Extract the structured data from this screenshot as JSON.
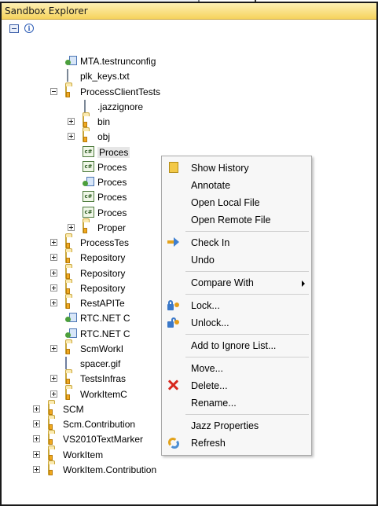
{
  "window": {
    "title": "Sandbox Explorer"
  },
  "toolbar": {
    "collapse_icon": "collapse-all-icon",
    "info_icon": "info-icon",
    "info_glyph": "i"
  },
  "tree": [
    {
      "label": "MTA.testrunconfig",
      "icon": "config-file-icon",
      "toggle": "",
      "indent": 2
    },
    {
      "label": "plk_keys.txt",
      "icon": "text-file-icon",
      "toggle": "",
      "indent": 2
    },
    {
      "label": "ProcessClientTests",
      "icon": "folder-icon",
      "toggle": "minus",
      "indent": 2
    },
    {
      "label": ".jazzignore",
      "icon": "file-icon",
      "toggle": "",
      "indent": 3
    },
    {
      "label": "bin",
      "icon": "folder-icon",
      "toggle": "plus",
      "indent": 3
    },
    {
      "label": "obj",
      "icon": "folder-icon",
      "toggle": "plus",
      "indent": 3
    },
    {
      "label": "Proces",
      "icon": "csharp-file-icon",
      "toggle": "",
      "indent": 3,
      "selected": true
    },
    {
      "label": "Proces",
      "icon": "csharp-file-icon",
      "toggle": "",
      "indent": 3
    },
    {
      "label": "Proces",
      "icon": "config-file-icon",
      "toggle": "",
      "indent": 3
    },
    {
      "label": "Proces",
      "icon": "csharp-file-icon",
      "toggle": "",
      "indent": 3
    },
    {
      "label": "Proces",
      "icon": "csharp-file-icon",
      "toggle": "",
      "indent": 3
    },
    {
      "label": "Proper",
      "icon": "folder-icon",
      "toggle": "plus",
      "indent": 3
    },
    {
      "label": "ProcessTes",
      "icon": "folder-icon",
      "toggle": "plus",
      "indent": 2
    },
    {
      "label": "Repository",
      "icon": "folder-icon",
      "toggle": "plus",
      "indent": 2
    },
    {
      "label": "Repository",
      "icon": "folder-icon",
      "toggle": "plus",
      "indent": 2
    },
    {
      "label": "Repository",
      "icon": "folder-icon",
      "toggle": "plus",
      "indent": 2
    },
    {
      "label": "RestAPITe",
      "icon": "folder-icon",
      "toggle": "plus",
      "indent": 2
    },
    {
      "label": "RTC.NET C",
      "icon": "config-file-icon",
      "toggle": "",
      "indent": 2
    },
    {
      "label": "RTC.NET C",
      "icon": "config-file-icon",
      "toggle": "",
      "indent": 2
    },
    {
      "label": "ScmWorkI",
      "icon": "folder-icon",
      "toggle": "plus",
      "indent": 2
    },
    {
      "label": "spacer.gif",
      "icon": "image-file-icon",
      "toggle": "",
      "indent": 2
    },
    {
      "label": "TestsInfras",
      "icon": "folder-icon",
      "toggle": "plus",
      "indent": 2
    },
    {
      "label": "WorkItemC",
      "icon": "folder-icon",
      "toggle": "plus",
      "indent": 2
    },
    {
      "label": "SCM",
      "icon": "folder-icon",
      "toggle": "plus",
      "indent": 1
    },
    {
      "label": "Scm.Contribution",
      "icon": "folder-icon",
      "toggle": "plus",
      "indent": 1
    },
    {
      "label": "VS2010TextMarker",
      "icon": "folder-icon",
      "toggle": "plus",
      "indent": 1
    },
    {
      "label": "WorkItem",
      "icon": "folder-icon",
      "toggle": "plus",
      "indent": 1
    },
    {
      "label": "WorkItem.Contribution",
      "icon": "folder-icon",
      "toggle": "plus",
      "indent": 1
    }
  ],
  "context_menu": {
    "items": [
      {
        "label": "Show History",
        "icon": "history-icon"
      },
      {
        "label": "Annotate",
        "icon": ""
      },
      {
        "label": "Open Local File",
        "icon": ""
      },
      {
        "label": "Open Remote File",
        "icon": ""
      },
      {
        "separator": true
      },
      {
        "label": "Check In",
        "icon": "check-in-icon"
      },
      {
        "label": "Undo",
        "icon": ""
      },
      {
        "separator": true
      },
      {
        "label": "Compare With",
        "icon": "",
        "submenu": true
      },
      {
        "separator": true
      },
      {
        "label": "Lock...",
        "icon": "lock-icon"
      },
      {
        "label": "Unlock...",
        "icon": "unlock-icon"
      },
      {
        "separator": true
      },
      {
        "label": "Add to Ignore List...",
        "icon": ""
      },
      {
        "separator": true
      },
      {
        "label": "Move...",
        "icon": ""
      },
      {
        "label": "Delete...",
        "icon": "delete-icon"
      },
      {
        "label": "Rename...",
        "icon": ""
      },
      {
        "separator": true
      },
      {
        "label": "Jazz Properties",
        "icon": ""
      },
      {
        "label": "Refresh",
        "icon": "refresh-icon"
      }
    ]
  }
}
